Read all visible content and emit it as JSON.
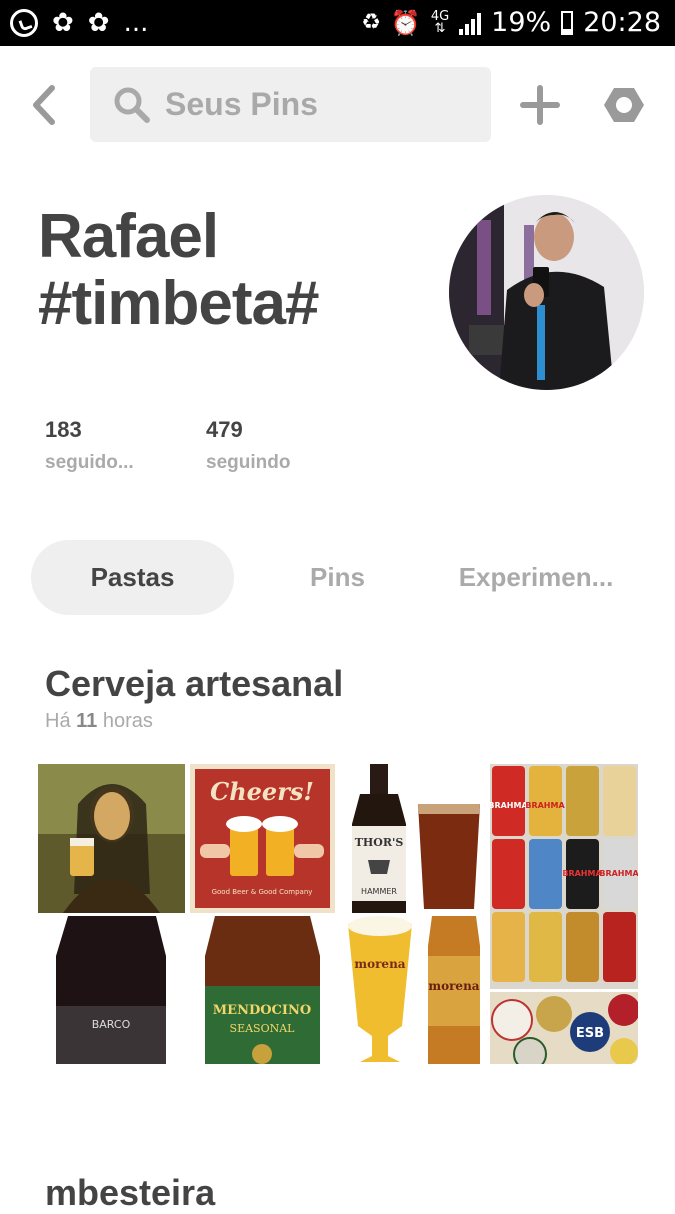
{
  "status_bar": {
    "left_dots": "...",
    "network": "4G",
    "battery": "19%",
    "time": "20:28"
  },
  "search": {
    "placeholder": "Seus Pins"
  },
  "profile": {
    "name_line1": "Rafael",
    "name_line2": "#timbeta#",
    "followers_count": "183",
    "followers_label": "seguido...",
    "following_count": "479",
    "following_label": "seguindo"
  },
  "tabs": [
    {
      "label": "Pastas",
      "active": true
    },
    {
      "label": "Pins",
      "active": false
    },
    {
      "label": "Experimen...",
      "active": false
    }
  ],
  "boards": [
    {
      "title": "Cerveja artesanal",
      "meta_prefix": "Há",
      "meta_count": "11",
      "meta_suffix": "horas",
      "pins": [
        {
          "image": "mona-lisa-beer"
        },
        {
          "image": "cheers-poster",
          "text": "Cheers!",
          "caption": "Good Beer & Good Company"
        },
        {
          "image": "thors-hammer-bottle",
          "text": "THOR'S",
          "caption": "HAMMER"
        },
        {
          "image": "brahma-cans",
          "text": "BRAHMA"
        },
        {
          "image": "barco-bottle",
          "text": "BARCO"
        },
        {
          "image": "mendocino-bottle",
          "text": "MENDOCINO",
          "caption": "SEASONAL"
        },
        {
          "image": "morena-beer",
          "text": "morena"
        },
        {
          "image": "beer-coasters",
          "text": "ESB"
        }
      ]
    },
    {
      "title": "mbesteira"
    }
  ]
}
